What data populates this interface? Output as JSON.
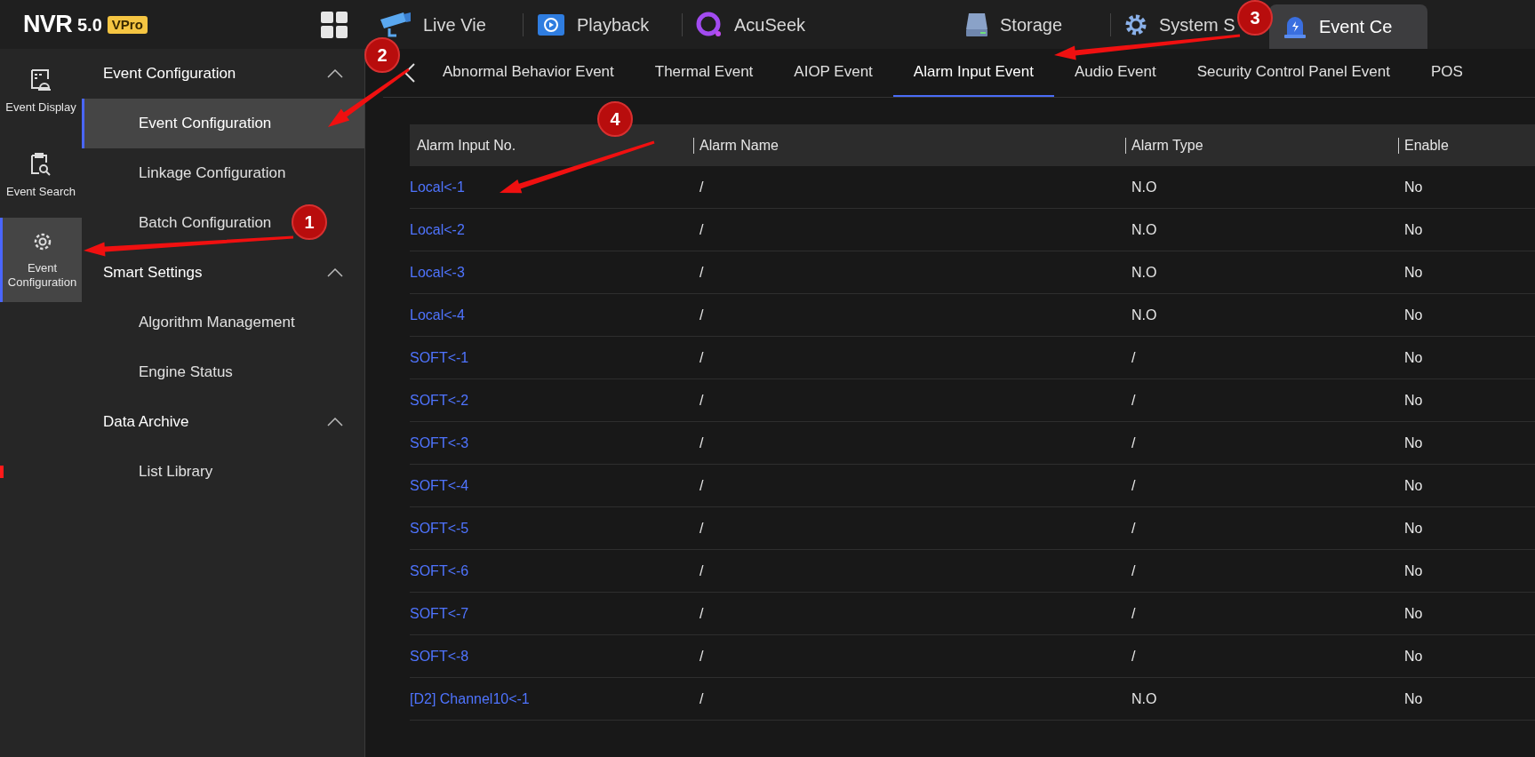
{
  "logo": {
    "name": "NVR",
    "version": "5.0",
    "badge": "VPro"
  },
  "nav": [
    {
      "label": "Live Vie",
      "selected": false
    },
    {
      "label": "Playback",
      "selected": false
    },
    {
      "label": "AcuSeek",
      "selected": false
    },
    {
      "label": "Storage",
      "selected": false
    },
    {
      "label": "System S",
      "selected": false
    },
    {
      "label": "Event Ce",
      "selected": true
    }
  ],
  "rail": [
    {
      "label": "Event Display",
      "selected": false
    },
    {
      "label": "Event Search",
      "selected": false
    },
    {
      "label": "Event Configuration",
      "selected": true
    }
  ],
  "menu": [
    {
      "label": "Event Configuration",
      "expanded": true,
      "children": [
        {
          "label": "Event Configuration",
          "selected": true
        },
        {
          "label": "Linkage Configuration",
          "selected": false
        },
        {
          "label": "Batch Configuration",
          "selected": false
        }
      ]
    },
    {
      "label": "Smart Settings",
      "expanded": true,
      "children": [
        {
          "label": "Algorithm Management",
          "selected": false
        },
        {
          "label": "Engine Status",
          "selected": false
        }
      ]
    },
    {
      "label": "Data Archive",
      "expanded": true,
      "children": [
        {
          "label": "List Library",
          "selected": false
        }
      ]
    }
  ],
  "tabs": [
    {
      "label": "Abnormal Behavior Event",
      "selected": false
    },
    {
      "label": "Thermal Event",
      "selected": false
    },
    {
      "label": "AIOP Event",
      "selected": false
    },
    {
      "label": "Alarm Input Event",
      "selected": true
    },
    {
      "label": "Audio Event",
      "selected": false
    },
    {
      "label": "Security Control Panel Event",
      "selected": false
    },
    {
      "label": "POS",
      "selected": false
    }
  ],
  "table": {
    "columns": [
      "Alarm Input No.",
      "Alarm Name",
      "Alarm Type",
      "Enable"
    ],
    "rows": [
      [
        "Local<-1",
        "/",
        "N.O",
        "No"
      ],
      [
        "Local<-2",
        "/",
        "N.O",
        "No"
      ],
      [
        "Local<-3",
        "/",
        "N.O",
        "No"
      ],
      [
        "Local<-4",
        "/",
        "N.O",
        "No"
      ],
      [
        "SOFT<-1",
        "/",
        "/",
        "No"
      ],
      [
        "SOFT<-2",
        "/",
        "/",
        "No"
      ],
      [
        "SOFT<-3",
        "/",
        "/",
        "No"
      ],
      [
        "SOFT<-4",
        "/",
        "/",
        "No"
      ],
      [
        "SOFT<-5",
        "/",
        "/",
        "No"
      ],
      [
        "SOFT<-6",
        "/",
        "/",
        "No"
      ],
      [
        "SOFT<-7",
        "/",
        "/",
        "No"
      ],
      [
        "SOFT<-8",
        "/",
        "/",
        "No"
      ],
      [
        "[D2] Channel10<-1",
        "/",
        "N.O",
        "No"
      ]
    ]
  },
  "annotations": [
    {
      "label": "1"
    },
    {
      "label": "2"
    },
    {
      "label": "3"
    },
    {
      "label": "4"
    }
  ]
}
